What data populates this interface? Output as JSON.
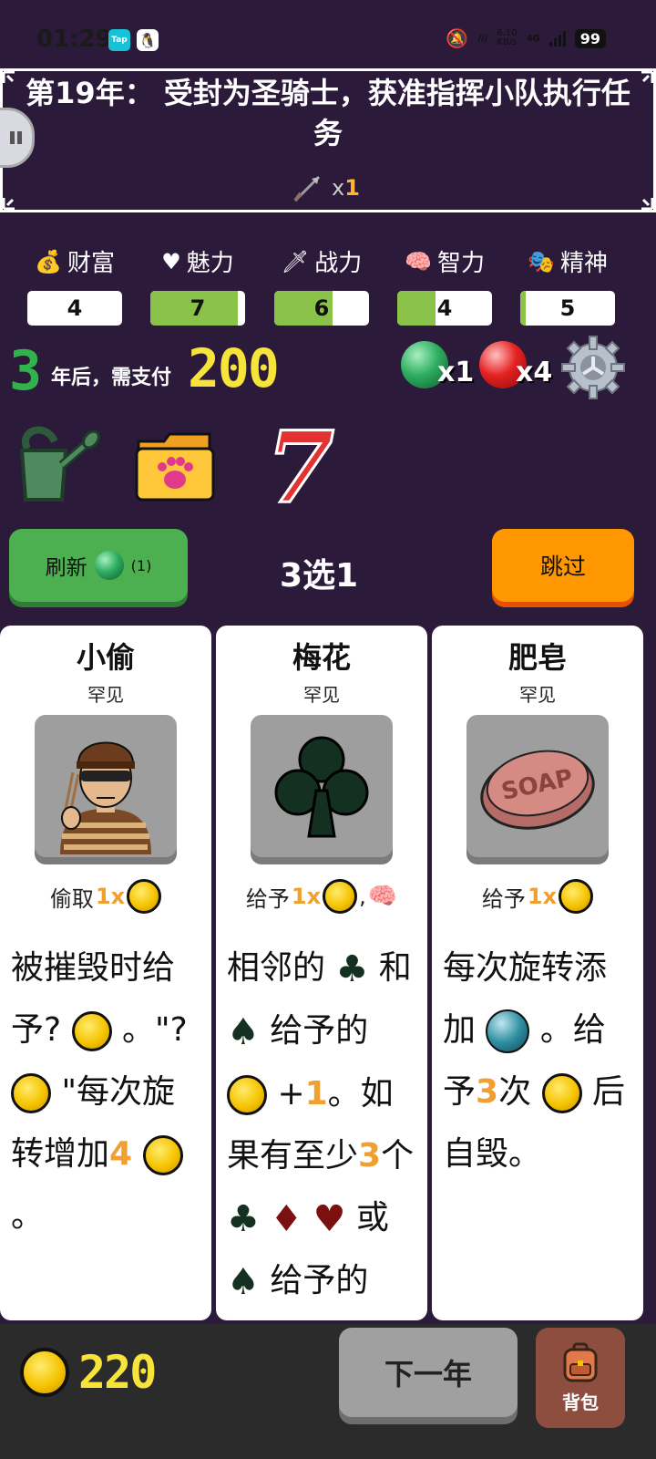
{
  "status_bar": {
    "time": "01:29",
    "tap_label": "Tap",
    "speed_top": "6.10",
    "speed_bottom": "KB/s",
    "network": "4G",
    "battery": "99"
  },
  "banner": {
    "title": "第19年： 受封为圣骑士，获准指挥小队执行任务",
    "arrow_prefix": "x",
    "arrow_count": "1"
  },
  "stats": [
    {
      "label": "财富",
      "icon": "money-bag-icon",
      "value": "4",
      "fill": 0
    },
    {
      "label": "魅力",
      "icon": "heart-icon",
      "value": "7",
      "fill": 0.92
    },
    {
      "label": "战力",
      "icon": "sword-icon",
      "value": "6",
      "fill": 0.62
    },
    {
      "label": "智力",
      "icon": "brain-icon",
      "value": "4",
      "fill": 0.4
    },
    {
      "label": "精神",
      "icon": "masks-icon",
      "value": "5",
      "fill": 0.06
    }
  ],
  "payment": {
    "years": "3",
    "text": "年后，需支付",
    "amount": "200"
  },
  "orbs": {
    "green_count": "x1",
    "red_count": "x4"
  },
  "items": {
    "seven": "7"
  },
  "actions": {
    "refresh_label": "刷新",
    "refresh_count": "(1)",
    "pick_label": "3选1",
    "skip_label": "跳过"
  },
  "cards": [
    {
      "name": "小偷",
      "rarity": "罕见",
      "effect_verb": "偷取",
      "effect_mult": "1x"
    },
    {
      "name": "梅花",
      "rarity": "罕见",
      "effect_verb": "给予",
      "effect_mult": "1x"
    },
    {
      "name": "肥皂",
      "rarity": "罕见",
      "effect_verb": "给予",
      "effect_mult": "1x",
      "art_text": "SOAP"
    }
  ],
  "card1_desc": {
    "a": "被摧毁时给予? ",
    "b": " 。\"? ",
    "c": " \"每次旋转增加",
    "n": "4",
    "d": " 。"
  },
  "card2_desc": {
    "a": "相邻的 ",
    "b": " 和 ",
    "c": " 给予的 ",
    "d": " +",
    "n1": "1",
    "e": "。如果有至少",
    "n2": "3",
    "f": "个 ",
    "g": " 或 ",
    "h": "给予的"
  },
  "card3_desc": {
    "a": "每次旋转添加 ",
    "b": " 。给予",
    "n": "3",
    "c": "次 ",
    "d": " 后自毁。"
  },
  "bottom": {
    "gold": "220",
    "next_label": "下一年",
    "bag_label": "背包"
  },
  "colors": {
    "background": "#2b1a3a",
    "green": "#4caf50",
    "orange": "#ff9800",
    "gold": "#f7e43a",
    "stat_fill": "#8bc34a"
  }
}
